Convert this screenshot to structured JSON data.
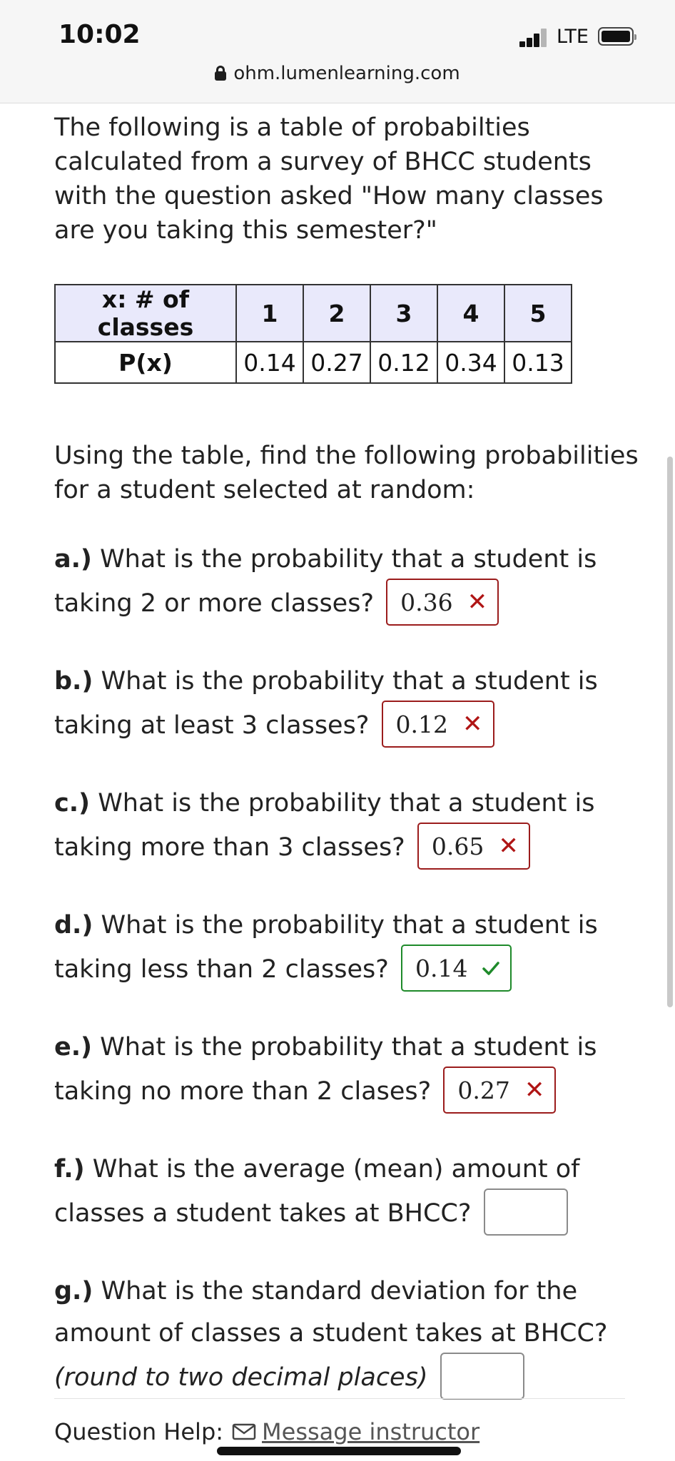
{
  "status": {
    "time": "10:02",
    "network": "LTE"
  },
  "browser": {
    "url": "ohm.lumenlearning.com"
  },
  "intro": "The following is a table of probabilties calculated from a survey of BHCC students with the question asked \"How many classes are you taking this semester?\"",
  "table": {
    "row_x_label": "x: # of classes",
    "x_values": [
      "1",
      "2",
      "3",
      "4",
      "5"
    ],
    "row_p_label": "P(x)",
    "p_values": [
      "0.14",
      "0.27",
      "0.12",
      "0.34",
      "0.13"
    ]
  },
  "using_text": "Using the table, find the following probabilities for a student selected at random:",
  "questions": [
    {
      "label": "a.)",
      "text": "What is the probability that a student is taking 2 or more classes?",
      "answer": "0.36",
      "status": "incorrect"
    },
    {
      "label": "b.)",
      "text": "What is the probability that a student is taking at least 3 classes?",
      "answer": "0.12",
      "status": "incorrect"
    },
    {
      "label": "c.)",
      "text": "What is the probability that a student is taking more than 3 classes?",
      "answer": "0.65",
      "status": "incorrect"
    },
    {
      "label": "d.)",
      "text": "What is the probability that a student is taking less than 2 classes?",
      "answer": "0.14",
      "status": "correct"
    },
    {
      "label": "e.)",
      "text": "What is the probability that a student is taking no more than 2 clases?",
      "answer": "0.27",
      "status": "incorrect"
    },
    {
      "label": "f.)",
      "text": "What is the average (mean) amount of classes a student takes at BHCC?",
      "answer": "",
      "status": "empty"
    },
    {
      "label": "g.)",
      "text": "What is the standard deviation for the amount of classes a student takes at BHCC?",
      "note": "(round to two decimal places)",
      "answer": "",
      "status": "empty"
    }
  ],
  "help": {
    "label": "Question Help:",
    "link": "Message instructor"
  },
  "colors": {
    "incorrect": "#b01515",
    "correct": "#1e8a2a",
    "table_header": "#e9e9fb"
  }
}
